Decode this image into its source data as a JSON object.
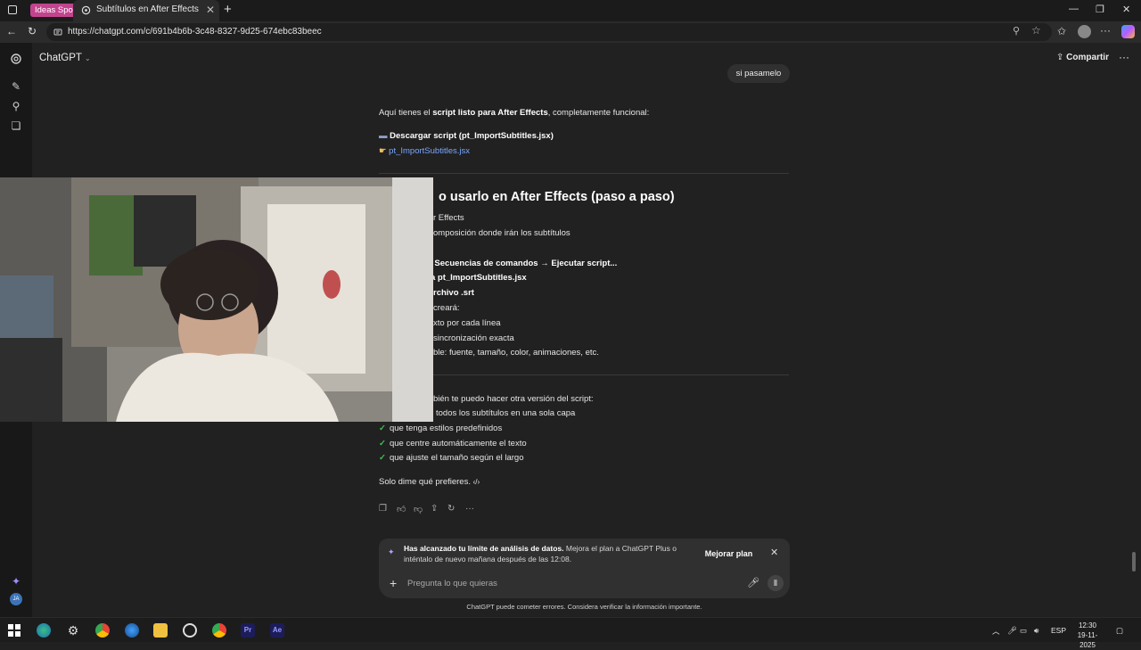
{
  "browser": {
    "tab_group": "Ideas Sport",
    "tab_title": "Subtítulos en After Effects",
    "url": "https://chatgpt.com/c/691b4b6b-3c48-8327-9d25-674ebc83beec"
  },
  "header": {
    "model": "ChatGPT",
    "share": "Compartir"
  },
  "conversation": {
    "user_message": "si pasamelo",
    "intro_pre": "Aquí tienes el ",
    "intro_bold": "script listo para After Effects",
    "intro_post": ", completamente funcional:",
    "download_label": "Descargar script (pt_ImportSubtitles.jsx)",
    "download_link": "pt_ImportSubtitles.jsx",
    "heading_visible": "o usarlo en After Effects (paso a paso)",
    "steps": [
      "r Effects",
      "omposición donde irán los subtítulos",
      "Secuencias de comandos → Ejecutar script...",
      "a pt_ImportSubtitles.jsx",
      "rchivo .srt",
      "creará:",
      "xto por cada línea",
      "sincronización exacta",
      "ble: fuente, tamaño, color, animaciones, etc."
    ],
    "also_visible": "bién te puedo hacer otra versión del script:",
    "options": [
      "todos los subtítulos en una sola capa",
      "que tenga estilos predefinidos",
      "que centre automáticamente el texto",
      "que ajuste el tamaño según el largo"
    ],
    "closing": "Solo dime qué prefieres."
  },
  "notice": {
    "bold": "Has alcanzado tu límite de análisis de datos.",
    "text": " Mejora el plan a ChatGPT Plus o inténtalo de nuevo mañana después de las 12:08.",
    "upgrade_button": "Mejorar plan"
  },
  "composer": {
    "placeholder": "Pregunta lo que quieras",
    "disclaimer": "ChatGPT puede cometer errores. Considera verificar la información importante."
  },
  "taskbar": {
    "language": "ESP",
    "time": "12:30",
    "date": "19-11-2025"
  },
  "colors": {
    "background": "#212121",
    "link": "#7aa7ff",
    "check": "#3fbf4f",
    "tab_group": "#c2448f"
  }
}
